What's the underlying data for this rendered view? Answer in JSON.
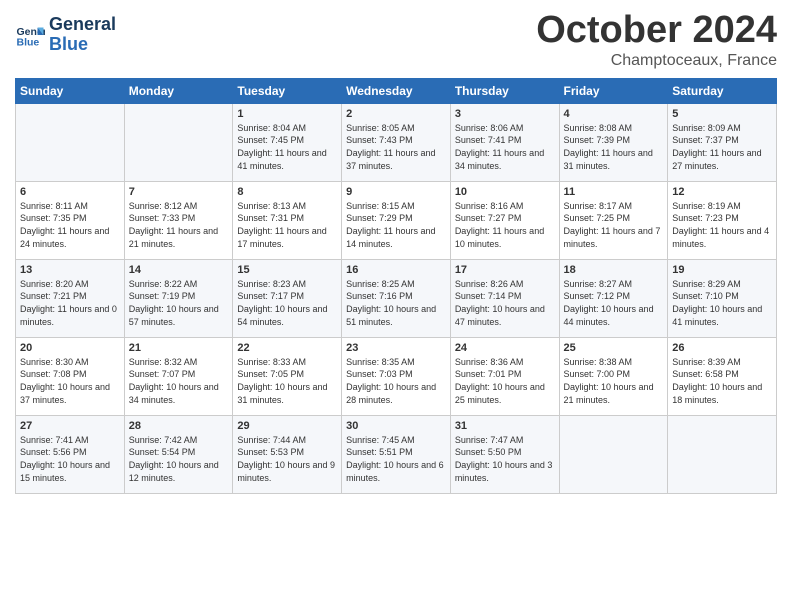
{
  "header": {
    "logo_line1": "General",
    "logo_line2": "Blue",
    "month": "October 2024",
    "location": "Champtoceaux, France"
  },
  "weekdays": [
    "Sunday",
    "Monday",
    "Tuesday",
    "Wednesday",
    "Thursday",
    "Friday",
    "Saturday"
  ],
  "weeks": [
    [
      {
        "day": "",
        "sunrise": "",
        "sunset": "",
        "daylight": ""
      },
      {
        "day": "",
        "sunrise": "",
        "sunset": "",
        "daylight": ""
      },
      {
        "day": "1",
        "sunrise": "Sunrise: 8:04 AM",
        "sunset": "Sunset: 7:45 PM",
        "daylight": "Daylight: 11 hours and 41 minutes."
      },
      {
        "day": "2",
        "sunrise": "Sunrise: 8:05 AM",
        "sunset": "Sunset: 7:43 PM",
        "daylight": "Daylight: 11 hours and 37 minutes."
      },
      {
        "day": "3",
        "sunrise": "Sunrise: 8:06 AM",
        "sunset": "Sunset: 7:41 PM",
        "daylight": "Daylight: 11 hours and 34 minutes."
      },
      {
        "day": "4",
        "sunrise": "Sunrise: 8:08 AM",
        "sunset": "Sunset: 7:39 PM",
        "daylight": "Daylight: 11 hours and 31 minutes."
      },
      {
        "day": "5",
        "sunrise": "Sunrise: 8:09 AM",
        "sunset": "Sunset: 7:37 PM",
        "daylight": "Daylight: 11 hours and 27 minutes."
      }
    ],
    [
      {
        "day": "6",
        "sunrise": "Sunrise: 8:11 AM",
        "sunset": "Sunset: 7:35 PM",
        "daylight": "Daylight: 11 hours and 24 minutes."
      },
      {
        "day": "7",
        "sunrise": "Sunrise: 8:12 AM",
        "sunset": "Sunset: 7:33 PM",
        "daylight": "Daylight: 11 hours and 21 minutes."
      },
      {
        "day": "8",
        "sunrise": "Sunrise: 8:13 AM",
        "sunset": "Sunset: 7:31 PM",
        "daylight": "Daylight: 11 hours and 17 minutes."
      },
      {
        "day": "9",
        "sunrise": "Sunrise: 8:15 AM",
        "sunset": "Sunset: 7:29 PM",
        "daylight": "Daylight: 11 hours and 14 minutes."
      },
      {
        "day": "10",
        "sunrise": "Sunrise: 8:16 AM",
        "sunset": "Sunset: 7:27 PM",
        "daylight": "Daylight: 11 hours and 10 minutes."
      },
      {
        "day": "11",
        "sunrise": "Sunrise: 8:17 AM",
        "sunset": "Sunset: 7:25 PM",
        "daylight": "Daylight: 11 hours and 7 minutes."
      },
      {
        "day": "12",
        "sunrise": "Sunrise: 8:19 AM",
        "sunset": "Sunset: 7:23 PM",
        "daylight": "Daylight: 11 hours and 4 minutes."
      }
    ],
    [
      {
        "day": "13",
        "sunrise": "Sunrise: 8:20 AM",
        "sunset": "Sunset: 7:21 PM",
        "daylight": "Daylight: 11 hours and 0 minutes."
      },
      {
        "day": "14",
        "sunrise": "Sunrise: 8:22 AM",
        "sunset": "Sunset: 7:19 PM",
        "daylight": "Daylight: 10 hours and 57 minutes."
      },
      {
        "day": "15",
        "sunrise": "Sunrise: 8:23 AM",
        "sunset": "Sunset: 7:17 PM",
        "daylight": "Daylight: 10 hours and 54 minutes."
      },
      {
        "day": "16",
        "sunrise": "Sunrise: 8:25 AM",
        "sunset": "Sunset: 7:16 PM",
        "daylight": "Daylight: 10 hours and 51 minutes."
      },
      {
        "day": "17",
        "sunrise": "Sunrise: 8:26 AM",
        "sunset": "Sunset: 7:14 PM",
        "daylight": "Daylight: 10 hours and 47 minutes."
      },
      {
        "day": "18",
        "sunrise": "Sunrise: 8:27 AM",
        "sunset": "Sunset: 7:12 PM",
        "daylight": "Daylight: 10 hours and 44 minutes."
      },
      {
        "day": "19",
        "sunrise": "Sunrise: 8:29 AM",
        "sunset": "Sunset: 7:10 PM",
        "daylight": "Daylight: 10 hours and 41 minutes."
      }
    ],
    [
      {
        "day": "20",
        "sunrise": "Sunrise: 8:30 AM",
        "sunset": "Sunset: 7:08 PM",
        "daylight": "Daylight: 10 hours and 37 minutes."
      },
      {
        "day": "21",
        "sunrise": "Sunrise: 8:32 AM",
        "sunset": "Sunset: 7:07 PM",
        "daylight": "Daylight: 10 hours and 34 minutes."
      },
      {
        "day": "22",
        "sunrise": "Sunrise: 8:33 AM",
        "sunset": "Sunset: 7:05 PM",
        "daylight": "Daylight: 10 hours and 31 minutes."
      },
      {
        "day": "23",
        "sunrise": "Sunrise: 8:35 AM",
        "sunset": "Sunset: 7:03 PM",
        "daylight": "Daylight: 10 hours and 28 minutes."
      },
      {
        "day": "24",
        "sunrise": "Sunrise: 8:36 AM",
        "sunset": "Sunset: 7:01 PM",
        "daylight": "Daylight: 10 hours and 25 minutes."
      },
      {
        "day": "25",
        "sunrise": "Sunrise: 8:38 AM",
        "sunset": "Sunset: 7:00 PM",
        "daylight": "Daylight: 10 hours and 21 minutes."
      },
      {
        "day": "26",
        "sunrise": "Sunrise: 8:39 AM",
        "sunset": "Sunset: 6:58 PM",
        "daylight": "Daylight: 10 hours and 18 minutes."
      }
    ],
    [
      {
        "day": "27",
        "sunrise": "Sunrise: 7:41 AM",
        "sunset": "Sunset: 5:56 PM",
        "daylight": "Daylight: 10 hours and 15 minutes."
      },
      {
        "day": "28",
        "sunrise": "Sunrise: 7:42 AM",
        "sunset": "Sunset: 5:54 PM",
        "daylight": "Daylight: 10 hours and 12 minutes."
      },
      {
        "day": "29",
        "sunrise": "Sunrise: 7:44 AM",
        "sunset": "Sunset: 5:53 PM",
        "daylight": "Daylight: 10 hours and 9 minutes."
      },
      {
        "day": "30",
        "sunrise": "Sunrise: 7:45 AM",
        "sunset": "Sunset: 5:51 PM",
        "daylight": "Daylight: 10 hours and 6 minutes."
      },
      {
        "day": "31",
        "sunrise": "Sunrise: 7:47 AM",
        "sunset": "Sunset: 5:50 PM",
        "daylight": "Daylight: 10 hours and 3 minutes."
      },
      {
        "day": "",
        "sunrise": "",
        "sunset": "",
        "daylight": ""
      },
      {
        "day": "",
        "sunrise": "",
        "sunset": "",
        "daylight": ""
      }
    ]
  ]
}
